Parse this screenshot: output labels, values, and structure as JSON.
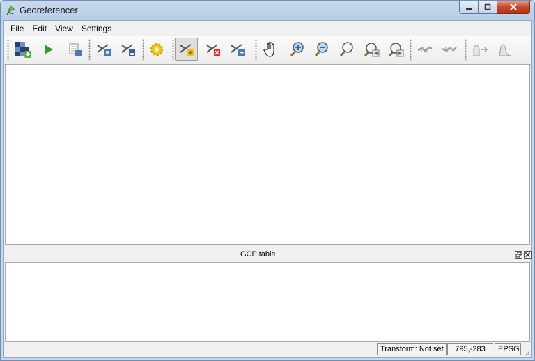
{
  "window": {
    "title": "Georeferencer"
  },
  "menu": {
    "items": [
      "File",
      "Edit",
      "View",
      "Settings"
    ]
  },
  "toolbar": {
    "buttons": [
      {
        "icon": "open-raster-icon"
      },
      {
        "icon": "start-georeferencing-icon"
      },
      {
        "icon": "generate-gdal-script-icon"
      },
      {
        "icon": "load-gcp-points-icon"
      },
      {
        "icon": "save-gcp-points-icon"
      },
      {
        "icon": "transformation-settings-icon"
      },
      {
        "icon": "add-point-icon",
        "active": true
      },
      {
        "icon": "delete-point-icon"
      },
      {
        "icon": "move-gcp-point-icon"
      },
      {
        "icon": "pan-icon"
      },
      {
        "icon": "zoom-in-icon"
      },
      {
        "icon": "zoom-out-icon"
      },
      {
        "icon": "zoom-to-layer-icon"
      },
      {
        "icon": "zoom-last-icon"
      },
      {
        "icon": "zoom-next-icon"
      },
      {
        "icon": "link-georeferencer-to-qgis-icon"
      },
      {
        "icon": "link-qgis-to-georeferencer-icon"
      },
      {
        "icon": "full-histogram-stretch-icon"
      },
      {
        "icon": "local-histogram-stretch-icon"
      }
    ]
  },
  "gcp_dock": {
    "title": "GCP table"
  },
  "status": {
    "transform": "Transform: Not set",
    "coordinates": "795,-283",
    "epsg": "EPSG:"
  },
  "colors": {
    "accent": "#3a6fb5",
    "titlebar": "#c9daee",
    "close": "#c6492c"
  }
}
